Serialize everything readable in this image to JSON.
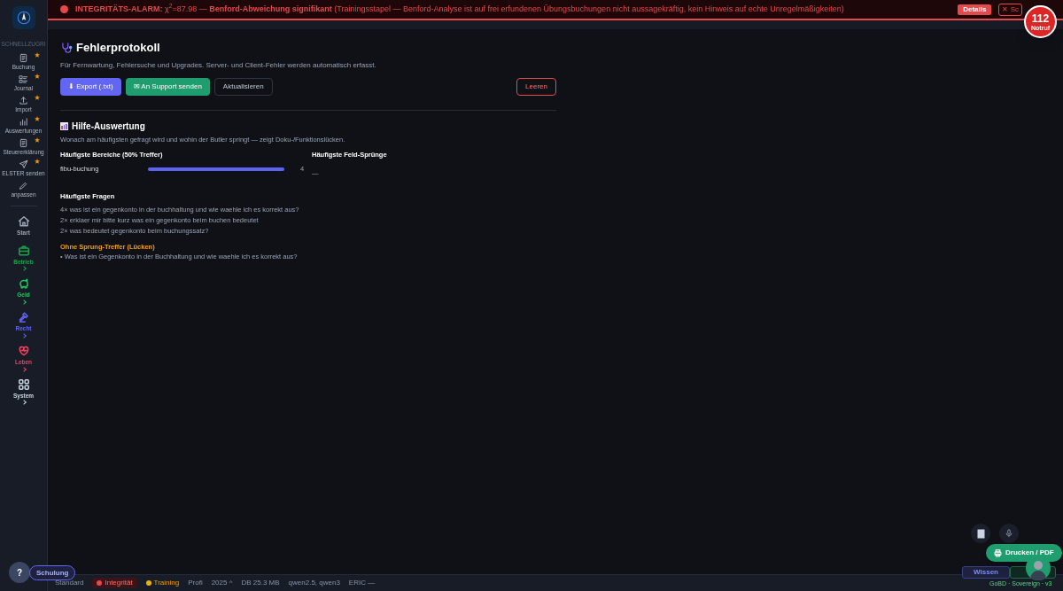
{
  "alarm": {
    "title": "INTEGRITÄTS-ALARM:",
    "stat": "χ$^{2}$=87.98 — ",
    "headline": "Benford-Abweichung signifikant",
    "detail": "(Trainingsstapel — Benford-Analyse ist auf frei erfundenen Übungsbuchungen nicht aussagekräftig, kein Hinweis auf echte Unregelmäßigkeiten)",
    "details_button": "Details",
    "close_button": "✕ Sc"
  },
  "emergency": {
    "number": "112",
    "label": "Notruf"
  },
  "sidebar": {
    "section": "SCHNELLZUGRI",
    "quick": [
      {
        "label": "Buchung",
        "starred": true
      },
      {
        "label": "Journal",
        "starred": true
      },
      {
        "label": "Import",
        "starred": true
      },
      {
        "label": "Auswertungen",
        "starred": true
      },
      {
        "label": "Steuererklärung",
        "starred": true
      },
      {
        "label": "ELSTER senden",
        "starred": true
      },
      {
        "label": "anpassen",
        "starred": false
      }
    ],
    "areas": [
      {
        "label": "Start",
        "color": "#9ca3af",
        "chevron": false
      },
      {
        "label": "Betrieb",
        "color": "#16a34a",
        "chevron": true
      },
      {
        "label": "Geld",
        "color": "#22c55e",
        "chevron": true
      },
      {
        "label": "Recht",
        "color": "#6366f1",
        "chevron": true
      },
      {
        "label": "Leben",
        "color": "#f43f5e",
        "chevron": true
      },
      {
        "label": "System",
        "color": "#cbd5e1",
        "chevron": true
      }
    ]
  },
  "page": {
    "title": "Fehlerprotokoll",
    "subtitle": "Für Fernwartung, Fehlersuche und Upgrades. Server- und Client-Fehler werden automatisch erfasst.",
    "buttons": [
      {
        "label": "⬇ Export (.txt)",
        "kind": "primary"
      },
      {
        "label": "✉ An Support senden",
        "kind": "success"
      },
      {
        "label": "Aktualisieren",
        "kind": "outline"
      },
      {
        "label": "Leeren",
        "kind": "danger"
      }
    ]
  },
  "help": {
    "title": "Hilfe-Auswertung",
    "subtitle": "Wonach am häufigsten gefragt wird und wohin der Butler springt — zeigt Doku-/Funktionslücken.",
    "areas_title": "Häufigste Bereiche (50% Treffer)",
    "areas": [
      {
        "name": "fibu-buchung",
        "level": 1,
        "count": "4"
      }
    ],
    "jumps_title": "Häufigste Feld-Sprünge",
    "jumps_empty": "—",
    "questions_title": "Häufigste Fragen",
    "questions": [
      "4× was ist ein gegenkonto in der buchhaltung und wie waehle ich es korrekt aus?",
      "2× erklaer mir bitte kurz was ein gegenkonto beim buchen bedeutet",
      "2× was bedeutet gegenkonto beim buchungssatz?"
    ],
    "gaps_title": "Ohne Sprung-Treffer (Lücken)",
    "gaps": [
      "• Was ist ein Gegenkonto in der Buchhaltung und wie waehle ich es korrekt aus?"
    ]
  },
  "help_button": "?",
  "training_button": "Schulung",
  "status_bar": [
    {
      "label": "Standard",
      "kind": "plain"
    },
    {
      "label": "Integrität",
      "kind": "alert"
    },
    {
      "label": "Training",
      "kind": "training"
    },
    {
      "label": "Profi",
      "kind": "plain"
    },
    {
      "label": "2025 ^",
      "kind": "plain"
    },
    {
      "label": "DB 25.3 MB",
      "kind": "plain"
    },
    {
      "label": "qwen2.5, qwen3",
      "kind": "plain"
    },
    {
      "label": "ERIC —",
      "kind": "plain"
    }
  ],
  "print_button": "Drucken / PDF",
  "knowledge_button": "Wissen",
  "version": "GoBD · Sovereign · v3"
}
